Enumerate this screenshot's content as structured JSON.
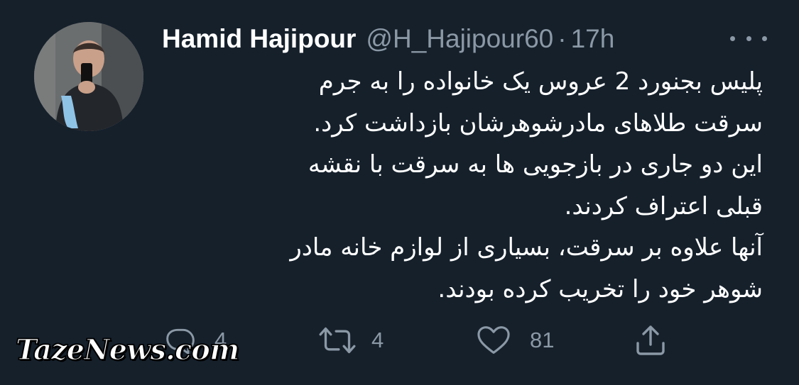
{
  "tweet": {
    "display_name": "Hamid Hajipour",
    "handle": "@H_Hajipour60",
    "separator": "·",
    "time": "17h",
    "text_lines": [
      "پلیس بجنورد 2 عروس یک خانواده را به جرم",
      "سرقت طلاهای مادرشوهرشان بازداشت کرد.",
      "این دو جاری در بازجویی ها به سرقت با نقشه",
      "قبلی اعتراف کردند.",
      "آنها علاوه بر سرقت، بسیاری از لوازم خانه مادر",
      "شوهر خود را تخریب کرده بودند."
    ]
  },
  "actions": {
    "reply": {
      "icon": "reply-icon",
      "count": "4"
    },
    "retweet": {
      "icon": "retweet-icon",
      "count": "4"
    },
    "like": {
      "icon": "heart-icon",
      "count": "81"
    },
    "share": {
      "icon": "share-icon"
    }
  },
  "watermark": {
    "text": "TazeNews.com"
  },
  "colors": {
    "background": "#15202b",
    "text": "#ffffff",
    "secondary": "#8b98a5"
  }
}
